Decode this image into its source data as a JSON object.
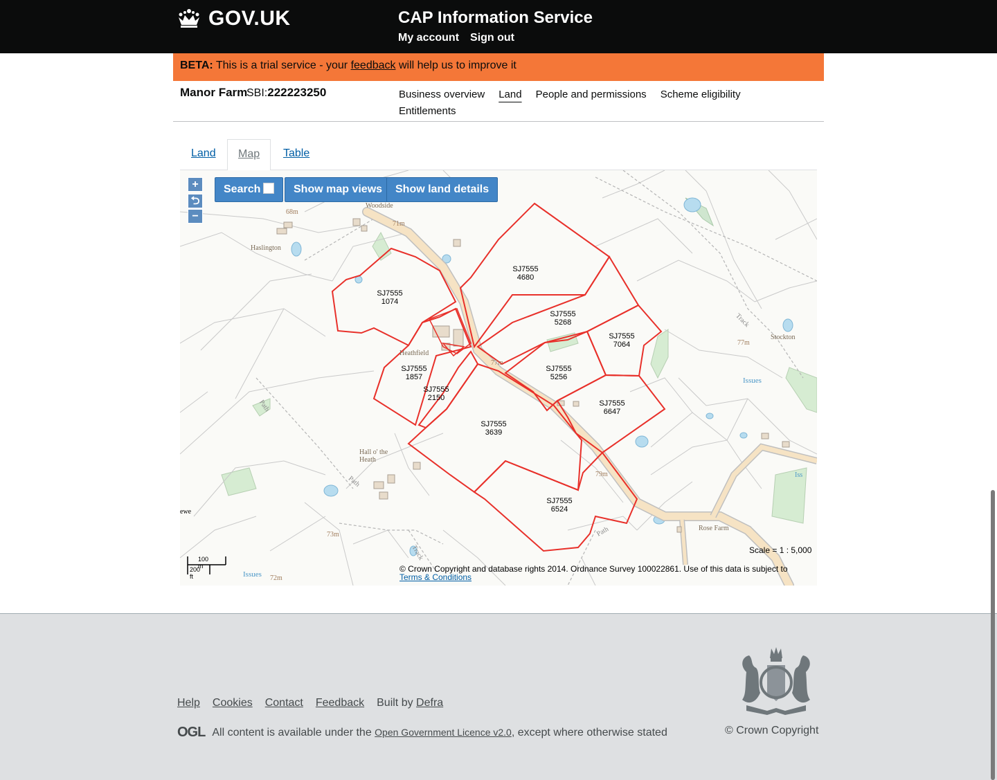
{
  "header": {
    "logo_text": "GOV.UK",
    "service_name": "CAP Information Service",
    "links": [
      "My account",
      "Sign out"
    ]
  },
  "beta": {
    "tag": "BETA:",
    "text_before": "This is a trial service - your",
    "link": "feedback",
    "text_after": "will help us to improve it"
  },
  "farm": {
    "name": "Manor Farm",
    "sbi_label": "SBI:",
    "sbi_value": "222223250",
    "nav": [
      "Business overview",
      "Land",
      "People and permissions",
      "Scheme eligibility",
      "Entitlements"
    ],
    "active_nav": "Land"
  },
  "tabs": [
    "Land",
    "Map",
    "Table"
  ],
  "active_tab": "Map",
  "map": {
    "controls": {
      "zoom_in": "+",
      "reset": "⮌",
      "zoom_out": "−"
    },
    "buttons": {
      "search": "Search",
      "map_views": "Show map views",
      "land_details": "Show land details"
    },
    "parcels": [
      {
        "sheet": "SJ7555",
        "id": "4680"
      },
      {
        "sheet": "SJ7555",
        "id": "1074"
      },
      {
        "sheet": "SJ7555",
        "id": "5268"
      },
      {
        "sheet": "SJ7555",
        "id": "7064"
      },
      {
        "sheet": "SJ7555",
        "id": "1857"
      },
      {
        "sheet": "SJ7555",
        "id": "5256"
      },
      {
        "sheet": "SJ7555",
        "id": "2150"
      },
      {
        "sheet": "SJ7555",
        "id": "6647"
      },
      {
        "sheet": "SJ7555",
        "id": "3639"
      },
      {
        "sheet": "SJ7555",
        "id": "6524"
      }
    ],
    "place_labels": [
      "Woodside",
      "Haslington",
      "68m",
      "71m",
      "Heathfield",
      "77m",
      "Hall o' the Heath",
      "73m",
      "79m",
      "Stockton",
      "77m",
      "Issues",
      "Rose Farm",
      "Issues",
      "72m",
      "Path",
      "Track",
      "Path",
      "Track",
      "Path",
      "ewe",
      "Iss"
    ],
    "scale_text": "Scale = 1 : 5,000",
    "scalebar_m": "100 m",
    "scalebar_ft": "200 ft",
    "copyright_text": "© Crown Copyright and database rights 2014. Ordnance Survey 100022861. Use of this data is subject to",
    "copyright_link": "Terms & Conditions",
    "colors": {
      "parcel": "#e8302a",
      "road": "#f6e3c4",
      "water": "#b7dcef",
      "wood": "#d6ecd2"
    }
  },
  "footer": {
    "links": [
      "Help",
      "Cookies",
      "Contact",
      "Feedback"
    ],
    "built_by": "Built by",
    "built_by_link": "Defra",
    "ogl": "OGL",
    "licence_before": "All content is available under the",
    "licence_link": "Open Government Licence v2.0",
    "licence_after": ", except where otherwise stated",
    "copyright": "© Crown Copyright"
  }
}
